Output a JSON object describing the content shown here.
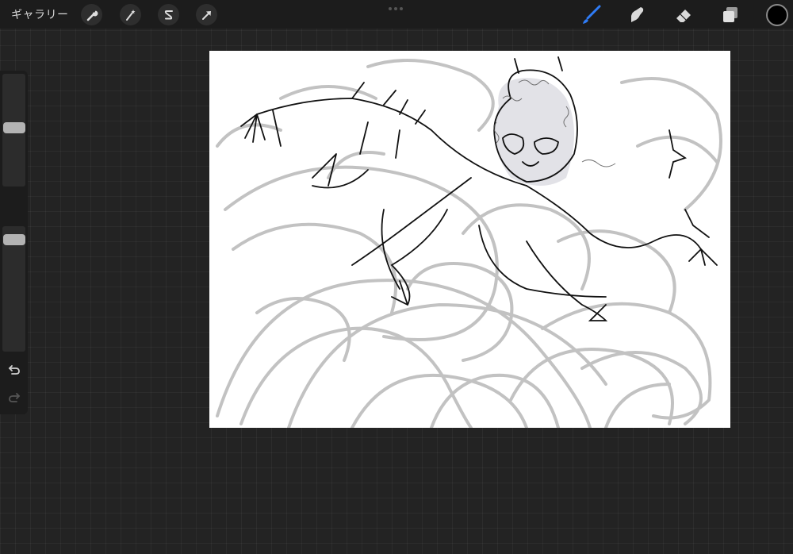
{
  "toolbar": {
    "gallery_label": "ギャラリー",
    "left_tools": [
      {
        "name": "actions",
        "icon": "wrench-icon"
      },
      {
        "name": "adjustments",
        "icon": "magic-wand-icon"
      },
      {
        "name": "selection",
        "icon": "selection-s-icon"
      },
      {
        "name": "transform",
        "icon": "arrow-cursor-icon"
      }
    ],
    "right_tools": [
      {
        "name": "brush",
        "icon": "brush-icon",
        "active": true
      },
      {
        "name": "smudge",
        "icon": "smudge-icon",
        "active": false
      },
      {
        "name": "eraser",
        "icon": "eraser-icon",
        "active": false
      },
      {
        "name": "layers",
        "icon": "layers-icon",
        "active": false
      }
    ],
    "current_color": "#000000",
    "accent_color": "#2f7cf6"
  },
  "sidebar": {
    "brush_size_level": 0.52,
    "opacity_level": 0.93,
    "undo_icon": "undo-icon",
    "redo_icon": "redo-icon",
    "modify_icon": "square-modify-icon"
  },
  "canvas": {
    "background": "#ffffff",
    "content": "sketch-drawing"
  }
}
